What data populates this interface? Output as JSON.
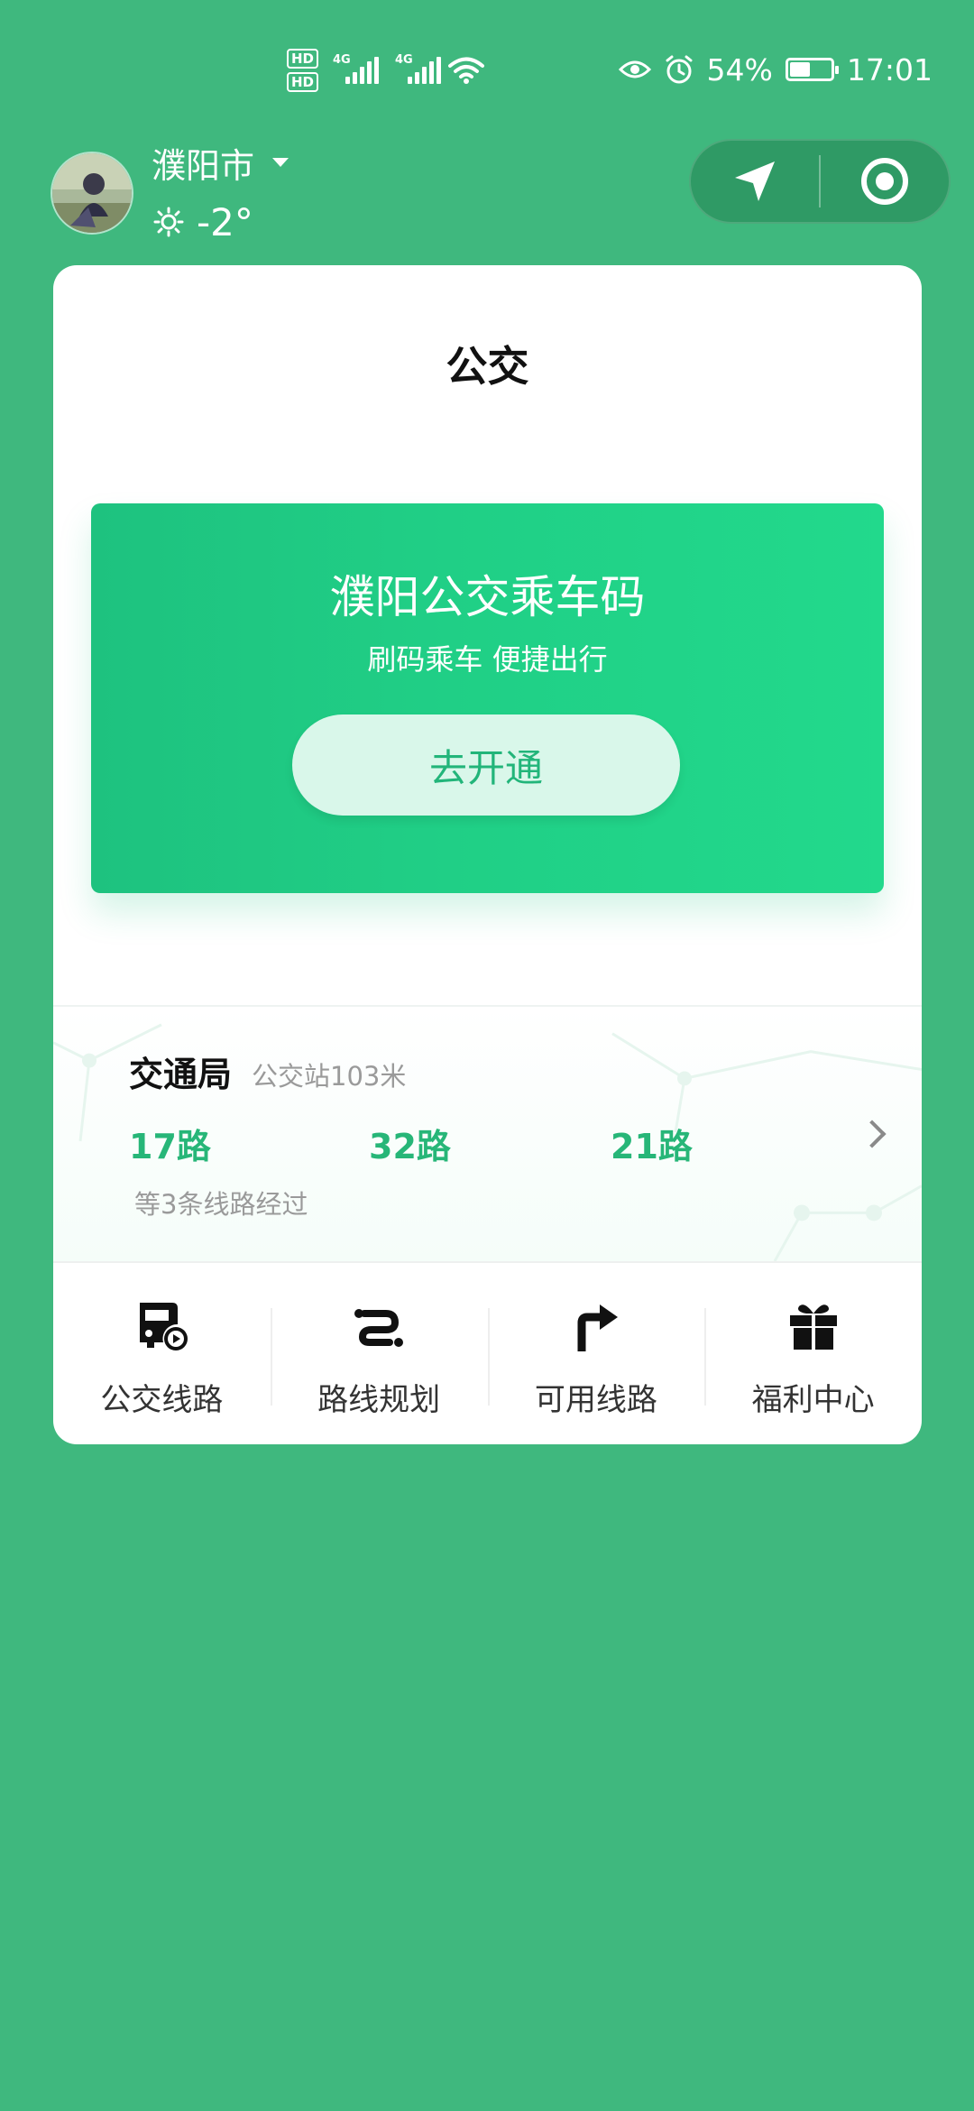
{
  "status_bar": {
    "hd1": "HD",
    "hd2": "HD",
    "net1": "4G",
    "net2": "4G",
    "battery_percent": "54%",
    "battery_level": 0.54,
    "time": "17:01",
    "icons": [
      "eye-icon",
      "alarm-icon",
      "battery-icon",
      "wifi-icon",
      "signal-icon"
    ]
  },
  "header": {
    "city": "濮阳市",
    "temperature": "-2°",
    "weather_icon": "sun-icon"
  },
  "card": {
    "title": "公交",
    "promo": {
      "title": "濮阳公交乘车码",
      "subtitle": "刷码乘车 便捷出行",
      "button": "去开通"
    },
    "stop": {
      "name": "交通局",
      "distance": "公交站103米",
      "routes": [
        "17路",
        "32路",
        "21路"
      ],
      "note": "等3条线路经过"
    },
    "nav": [
      {
        "label": "公交线路",
        "icon": "bus-clock-icon"
      },
      {
        "label": "路线规划",
        "icon": "route-plan-icon"
      },
      {
        "label": "可用线路",
        "icon": "turn-right-icon"
      },
      {
        "label": "福利中心",
        "icon": "gift-icon"
      }
    ]
  },
  "colors": {
    "background": "#3fb87e",
    "accent": "#27b678",
    "promo": "#1ec27f"
  }
}
